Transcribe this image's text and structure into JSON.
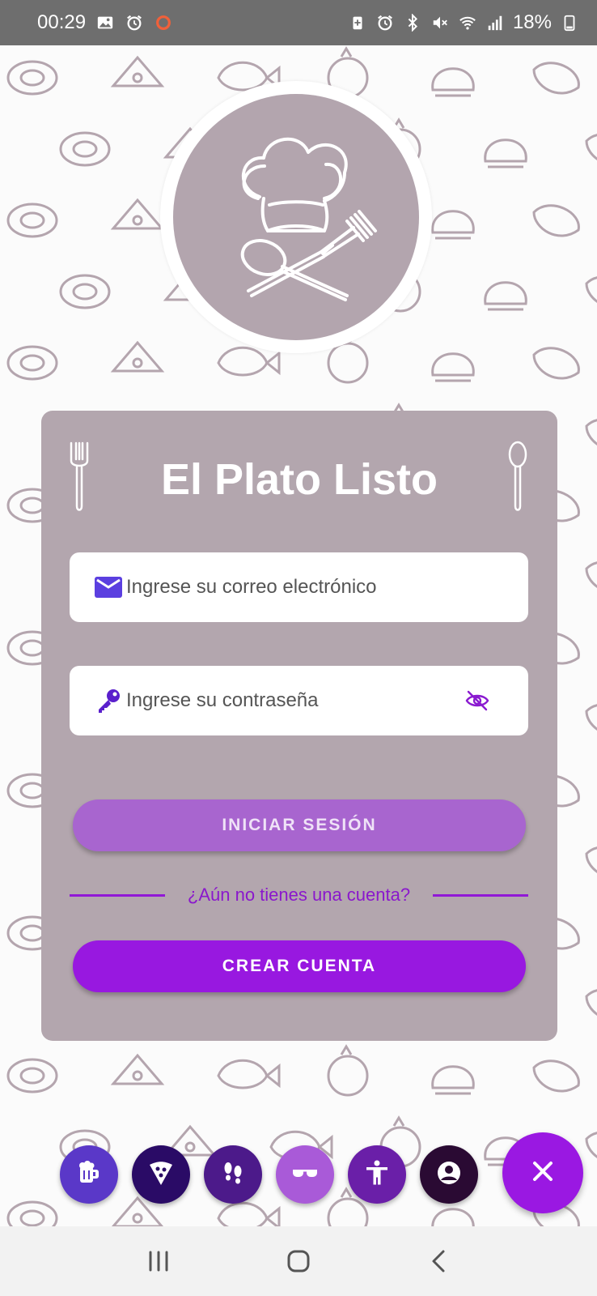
{
  "status_bar": {
    "time": "00:29",
    "battery": "18%",
    "left_icons": [
      "image-icon",
      "alarm-icon",
      "record-icon"
    ],
    "right_icons": [
      "battery-saver-icon",
      "alarm-icon",
      "bluetooth-icon",
      "mute-icon",
      "wifi-icon",
      "signal-icon",
      "battery-icon"
    ]
  },
  "logo": {
    "icon": "chef-hat-utensils-icon"
  },
  "card": {
    "title": "El Plato Listo",
    "email": {
      "placeholder": "Ingrese su correo electrónico",
      "icon": "envelope-icon"
    },
    "password": {
      "placeholder": "Ingrese su contraseña",
      "icon": "key-icon",
      "toggle_icon": "eye-off-icon"
    },
    "login_label": "INICIAR SESIÓN",
    "divider_text": "¿Aún no tienes una cuenta?",
    "create_label": "CREAR CUENTA"
  },
  "fab_menu": {
    "items": [
      {
        "icon": "beer-mug-icon",
        "color": "#5a38c8"
      },
      {
        "icon": "pizza-icon",
        "color": "#2a0b66"
      },
      {
        "icon": "footprints-icon",
        "color": "#4c1a8a"
      },
      {
        "icon": "glasses-icon",
        "color": "#a95ad8"
      },
      {
        "icon": "accessibility-icon",
        "color": "#6a1fa8"
      },
      {
        "icon": "account-icon",
        "color": "#2a0a33"
      }
    ],
    "close_icon": "close-icon",
    "close_color": "#9a18e2"
  },
  "nav_bar": {
    "items": [
      "recent-apps-icon",
      "home-icon",
      "back-icon"
    ]
  },
  "colors": {
    "card": "#b3a6ae",
    "accent": "#9818e0",
    "login_button": "#a865cf"
  }
}
